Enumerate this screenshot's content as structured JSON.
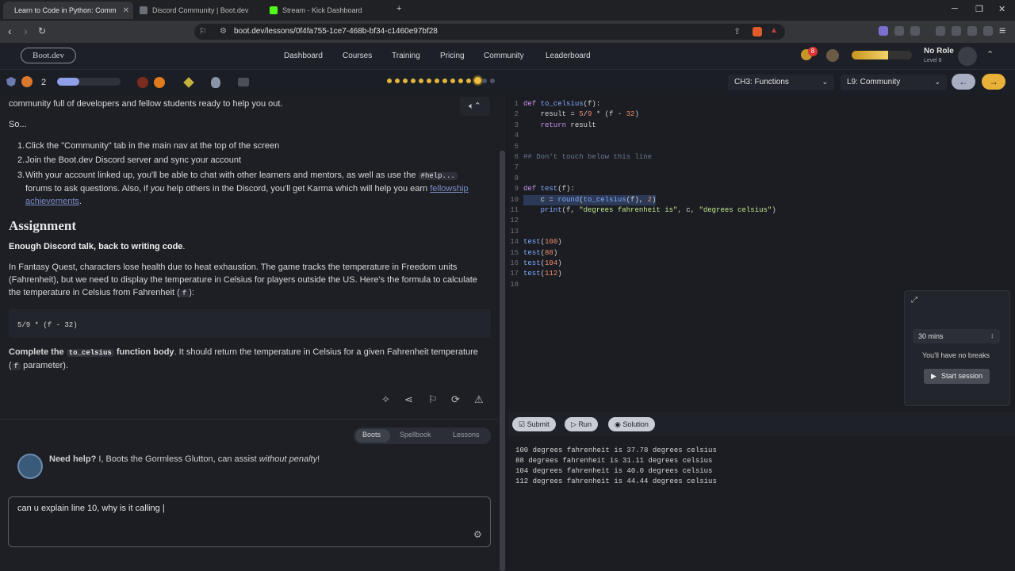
{
  "browser": {
    "tabs": [
      {
        "label": "Learn to Code in Python: Comm",
        "active": true
      },
      {
        "label": "Discord Community | Boot.dev",
        "active": false
      },
      {
        "label": "Stream - Kick Dashboard",
        "active": false
      }
    ],
    "url": "boot.dev/lessons/0f4fa755-1ce7-468b-bf34-c1460e97bf28",
    "ext_badge": "8"
  },
  "site": {
    "logo": "Boot.dev",
    "nav": [
      "Dashboard",
      "Courses",
      "Training",
      "Pricing",
      "Community",
      "Leaderboard"
    ],
    "user": {
      "name": "No Role",
      "level": "Level 8"
    },
    "xp_progress": 0.6,
    "streak": "2"
  },
  "lesson_nav": {
    "chapter": "CH3: Functions",
    "lesson": "L9: Community"
  },
  "lesson": {
    "intro": "community full of developers and fellow students ready to help you out.",
    "so": "So...",
    "steps": [
      "Click the \"Community\" tab in the main nav at the top of the screen",
      "Join the Boot.dev Discord server and sync your account"
    ],
    "step3_a": "With your account linked up, you'll be able to chat with other learners and mentors, as well as use the",
    "step3_code": "#help...",
    "step3_b": "forums to ask questions. Also, if",
    "step3_you": "you",
    "step3_c": "help others in the Discord, you'll get Karma which will help you earn",
    "step3_link": "fellowship achievements",
    "assignment_heading": "Assignment",
    "bold_line": "Enough Discord talk, back to writing code",
    "para1": "In Fantasy Quest, characters lose health due to heat exhaustion. The game tracks the temperature in Freedom units (Fahrenheit), but we need to display the temperature in Celsius for players outside the US. Here's the formula to calculate the temperature in Celsius from Fahrenheit (",
    "para1_code": "f",
    "para1_end": "):",
    "formula": "5/9 * (f - 32)",
    "complete_a": "Complete the",
    "complete_code": "to_celsius",
    "complete_b": "function body",
    "complete_c": ". It should return the temperature in Celsius for a given Fahrenheit temperature (",
    "complete_code2": "f",
    "complete_d": "parameter)."
  },
  "chat": {
    "tabs": [
      "Boots",
      "Spellbook",
      "Lessons"
    ],
    "need_help": "Need help?",
    "help_text": "I, Boots the Gormless Glutton, can assist",
    "help_em": "without penalty",
    "input_value": "can u explain line 10, why is it calling |"
  },
  "editor": {
    "lines": [
      {
        "n": "1",
        "html": "def to_celsius(f):"
      },
      {
        "n": "2",
        "html": "    result = 5/9 * (f - 32)"
      },
      {
        "n": "3",
        "html": "    return result"
      },
      {
        "n": "4",
        "html": ""
      },
      {
        "n": "5",
        "html": ""
      },
      {
        "n": "6",
        "html": "## Don't touch below this line"
      },
      {
        "n": "7",
        "html": ""
      },
      {
        "n": "8",
        "html": ""
      },
      {
        "n": "9",
        "html": "def test(f):"
      },
      {
        "n": "10",
        "html": "    c = round(to_celsius(f), 2)"
      },
      {
        "n": "11",
        "html": "    print(f, \"degrees fahrenheit is\", c, \"degrees celsius\")"
      },
      {
        "n": "12",
        "html": ""
      },
      {
        "n": "13",
        "html": ""
      },
      {
        "n": "14",
        "html": "test(100)"
      },
      {
        "n": "15",
        "html": "test(88)"
      },
      {
        "n": "16",
        "html": "test(104)"
      },
      {
        "n": "17",
        "html": "test(112)"
      },
      {
        "n": "18",
        "html": ""
      }
    ]
  },
  "timer": {
    "duration": "30 mins",
    "note": "You'll have no breaks",
    "start": "Start session"
  },
  "actions": {
    "submit": "Submit",
    "run": "Run",
    "solution": "Solution"
  },
  "console": [
    "100 degrees fahrenheit is 37.78 degrees celsius",
    "88 degrees fahrenheit is 31.11 degrees celsius",
    "104 degrees fahrenheit is 40.0 degrees celsius",
    "112 degrees fahrenheit is 44.44 degrees celsius"
  ]
}
